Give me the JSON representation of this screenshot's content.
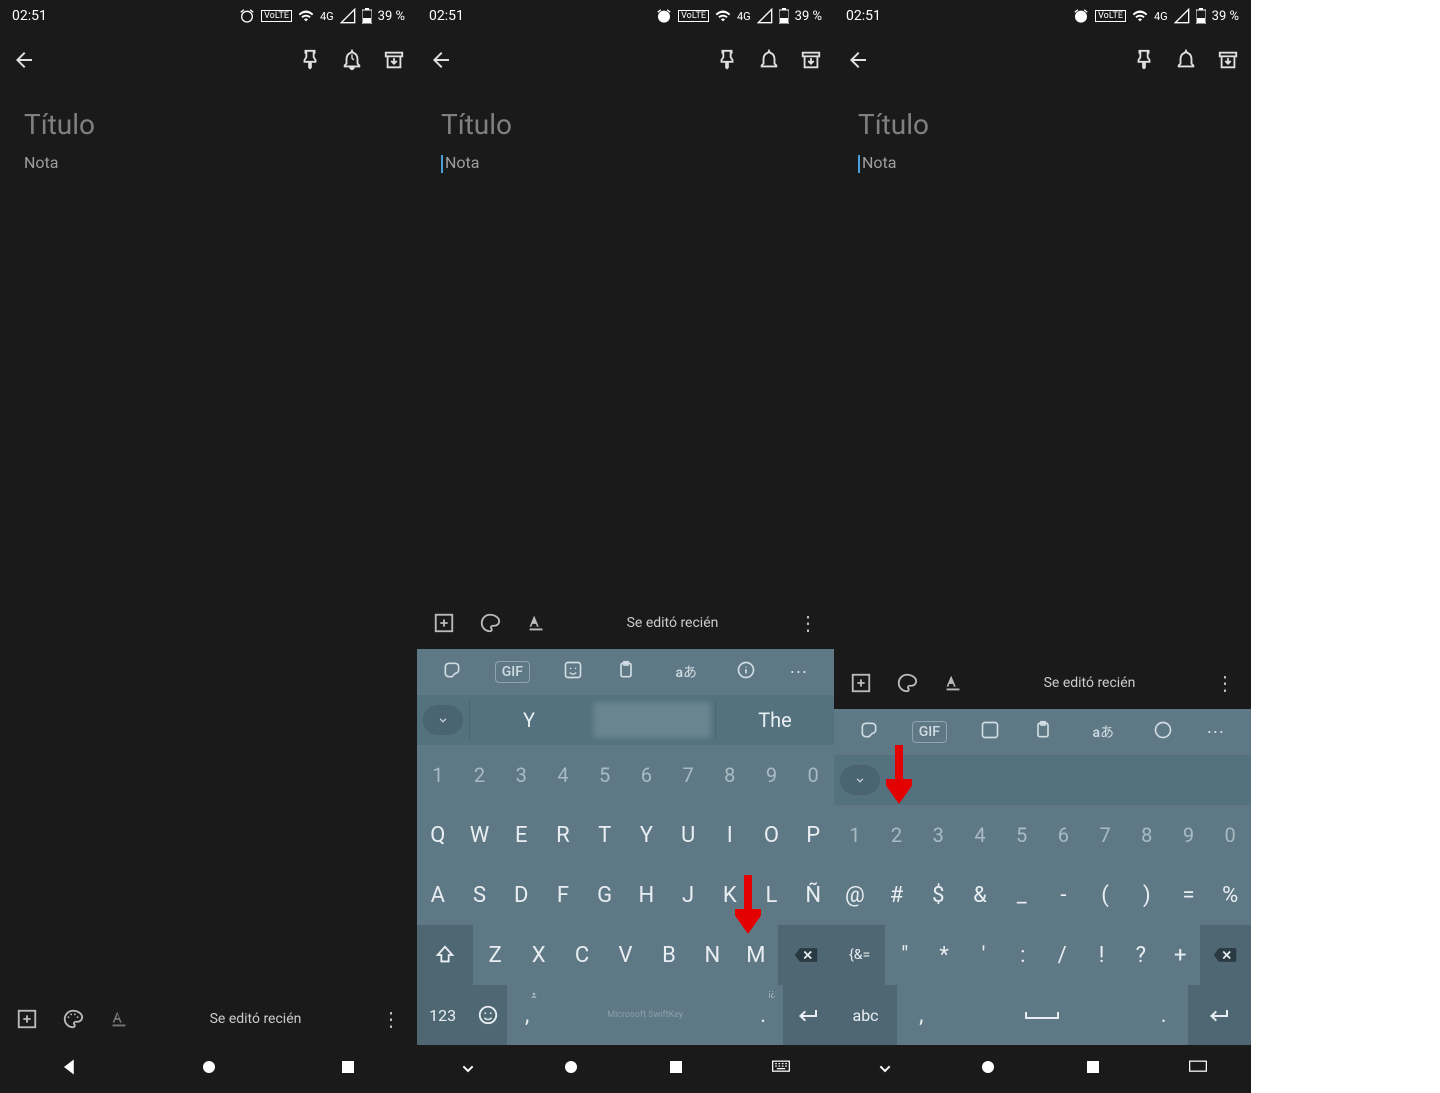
{
  "status": {
    "time": "02:51",
    "lte": "VoLTE",
    "signal": "4G",
    "battery": "39 %"
  },
  "note": {
    "title_placeholder": "Título",
    "body_placeholder": "Nota"
  },
  "toolbar": {
    "edited": "Se editó recién"
  },
  "keyboard": {
    "toolbar_gif": "GIF",
    "toolbar_lang": "aあ",
    "suggestions": [
      "Y",
      "",
      "The"
    ],
    "row_numbers": [
      "1",
      "2",
      "3",
      "4",
      "5",
      "6",
      "7",
      "8",
      "9",
      "0"
    ],
    "row_qwerty": [
      "Q",
      "W",
      "E",
      "R",
      "T",
      "Y",
      "U",
      "I",
      "O",
      "P"
    ],
    "row_asdf": [
      "A",
      "S",
      "D",
      "F",
      "G",
      "H",
      "J",
      "K",
      "L",
      "Ñ"
    ],
    "row_zxcv": [
      "Z",
      "X",
      "C",
      "V",
      "B",
      "N",
      "M"
    ],
    "key_123": "123",
    "key_comma": ",",
    "key_period": ".",
    "brand": "Microsoft SwiftKey",
    "sym_row2": [
      "@",
      "#",
      "$",
      "&",
      "_",
      "-",
      "(",
      ")",
      "=",
      "%"
    ],
    "sym_row3_first": "{&=",
    "sym_row3": [
      "\"",
      "*",
      "'",
      ":",
      "/",
      "!",
      "?",
      "+"
    ],
    "key_abc": "abc"
  }
}
